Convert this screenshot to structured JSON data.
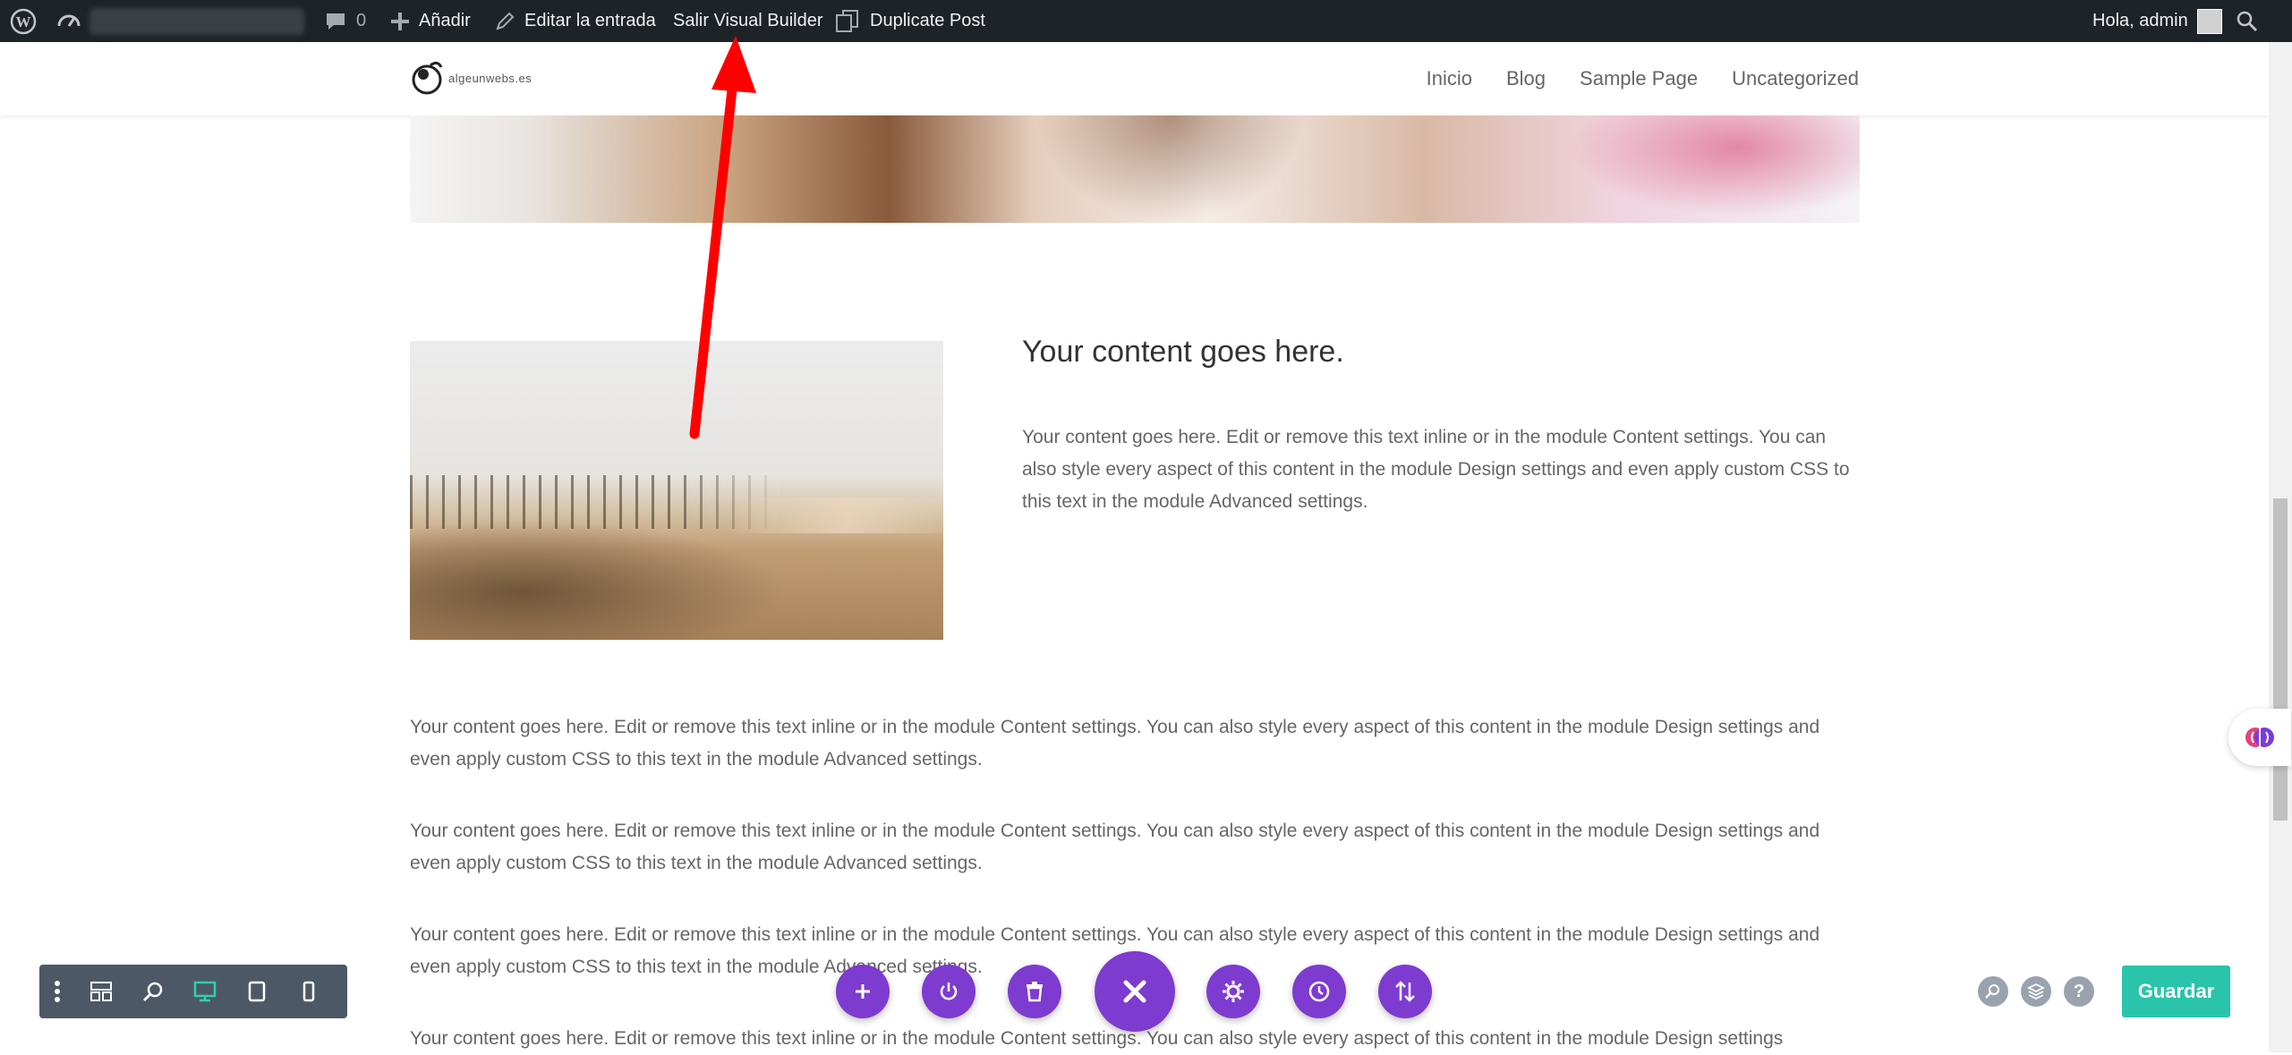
{
  "admin_bar": {
    "comments_count": "0",
    "new_label": "Añadir",
    "edit_label": "Editar la entrada",
    "exit_builder_label": "Salir Visual Builder",
    "duplicate_label": "Duplicate Post",
    "greeting": "Hola, admin"
  },
  "header": {
    "logo_text": "algeunwebs.es",
    "nav": [
      "Inicio",
      "Blog",
      "Sample Page",
      "Uncategorized"
    ]
  },
  "content": {
    "heading": "Your content goes here.",
    "side_text": "Your content goes here. Edit or remove this text inline or in the module Content settings. You can also style every aspect of this content in the module Design settings and even apply custom CSS to this text in the module Advanced settings.",
    "paragraphs": [
      "Your content goes here. Edit or remove this text inline or in the module Content settings. You can also style every aspect of this content in the module Design settings and even apply custom CSS to this text in the module Advanced settings.",
      "Your content goes here. Edit or remove this text inline or in the module Content settings. You can also style every aspect of this content in the module Design settings and even apply custom CSS to this text in the module Advanced settings.",
      "Your content goes here. Edit or remove this text inline or in the module Content settings. You can also style every aspect of this content in the module Design settings and even apply custom CSS to this text in the module Advanced settings.",
      "Your content goes here. Edit or remove this text inline or in the module Content settings. You can also style every aspect of this content in the module Design settings"
    ]
  },
  "builder": {
    "save_label": "Guardar",
    "help_label": "?",
    "active_view": "desktop",
    "view_icons": [
      "menu-dots-icon",
      "wireframe-icon",
      "zoom-icon",
      "desktop-icon",
      "tablet-icon",
      "phone-icon"
    ],
    "action_icons": [
      "add-icon",
      "power-icon",
      "trash-icon",
      "close-icon",
      "settings-icon",
      "history-icon",
      "sort-icon"
    ]
  },
  "colors": {
    "admin_bar_bg": "#1d2327",
    "divi_purple": "#7e3bd0",
    "save_green": "#29c4a9",
    "view_bar_bg": "#4c5866",
    "annotation_red": "#ff0000"
  }
}
